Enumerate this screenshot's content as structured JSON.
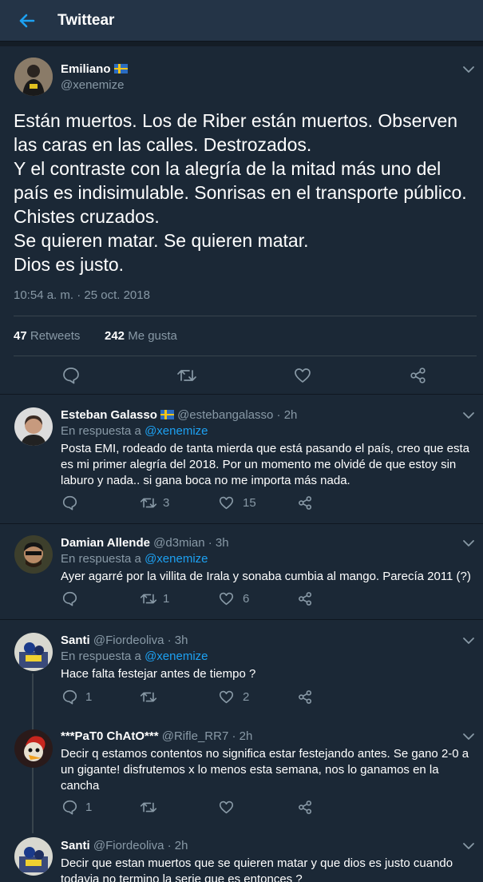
{
  "header": {
    "title": "Twittear"
  },
  "main_tweet": {
    "name": "Emiliano",
    "handle": "@xenemize",
    "text_lines": [
      "Están muertos. Los de Riber están muertos. Observen",
      "las caras en las calles. Destrozados.",
      "Y el contraste con la alegría de la mitad más uno del",
      "país es indisimulable. Sonrisas en el transporte público.",
      "Chistes cruzados.",
      "Se quieren matar. Se quieren matar.",
      "Dios es justo."
    ],
    "timestamp": "10:54 a. m. · 25 oct. 2018",
    "retweets_count": "47",
    "retweets_label": "Retweets",
    "likes_count": "242",
    "likes_label": "Me gusta"
  },
  "reply_prefix": "En respuesta a",
  "replies": [
    {
      "name": "Esteban Galasso",
      "handle": "@estebangalasso",
      "time": "· 2h",
      "reply_to": "@xenemize",
      "text_lines": [
        "Posta EMI, rodeado de tanta mierda que está pasando el país, creo que esta",
        "es mi primer alegría del 2018. Por un momento me olvidé de que estoy sin",
        "laburo y nada.. si gana boca no me importa más nada."
      ],
      "retweets": "3",
      "likes": "15"
    },
    {
      "name": "Damian Allende",
      "handle": "@d3mian",
      "time": "· 3h",
      "reply_to": "@xenemize",
      "text_lines": [
        "Ayer agarré por la villita de Irala y sonaba cumbia al mango. Parecía 2011 (?)"
      ],
      "retweets": "1",
      "likes": "6"
    },
    {
      "name": "Santi",
      "handle": "@Fiordeoliva",
      "time": "· 3h",
      "reply_to": "@xenemize",
      "text_lines": [
        "Hace falta festejar antes de tiempo ?"
      ],
      "replies_count": "1",
      "likes": "2"
    },
    {
      "name": "***PaT0 ChAtO***",
      "handle": "@Rifle_RR7",
      "time": "· 2h",
      "text_lines": [
        "Decir q estamos contentos no significa estar festejando antes. Se gano 2-0 a",
        "un gigante! disfrutemos x lo menos esta semana, nos lo ganamos en la",
        "cancha"
      ],
      "replies_count": "1"
    },
    {
      "name": "Santi",
      "handle": "@Fiordeoliva",
      "time": "· 2h",
      "text_lines": [
        "Decir que estan muertos que se quieren matar y que dios es justo cuando",
        "todavia no termino la serie que es entonces ?"
      ]
    }
  ],
  "colors": {
    "background": "#141d26",
    "card": "#1b2836",
    "header": "#243447",
    "muted": "#8899a6",
    "accent": "#1da1f2"
  }
}
